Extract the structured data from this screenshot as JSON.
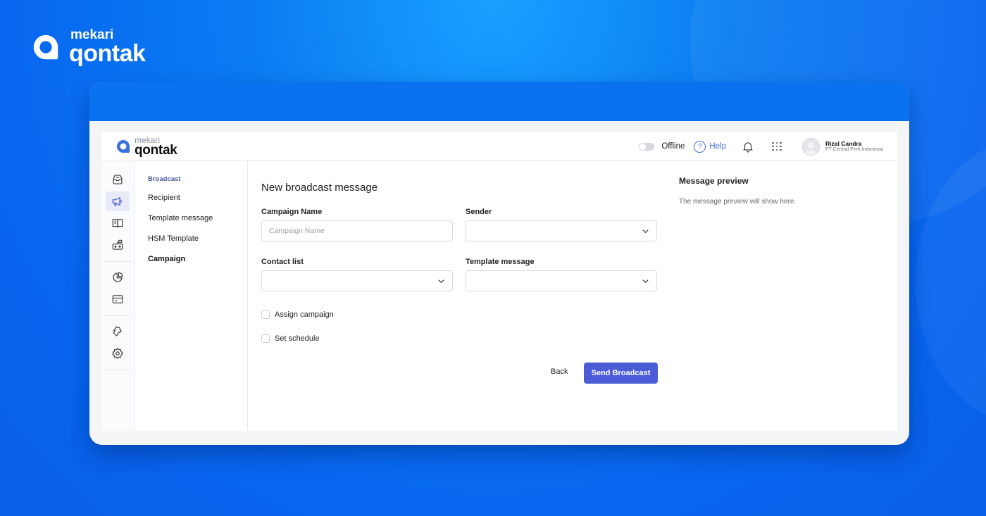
{
  "brand": {
    "small": "mekari",
    "big": "qontak"
  },
  "topbar": {
    "logo_small": "mekari",
    "logo_big": "qontak",
    "status_label": "Offline",
    "help_label": "Help",
    "help_glyph": "?",
    "user_name": "Rizal Candra",
    "user_company": "PT Central Perk Indonesia"
  },
  "rail": {
    "items": [
      {
        "icon": "inbox-icon",
        "active": false
      },
      {
        "icon": "megaphone-icon",
        "active": true
      },
      {
        "icon": "book-icon",
        "active": false
      },
      {
        "icon": "bot-icon",
        "active": false
      },
      {
        "icon": "pie-chart-icon",
        "active": false
      },
      {
        "icon": "credit-card-icon",
        "active": false
      },
      {
        "icon": "puzzle-icon",
        "active": false
      },
      {
        "icon": "gear-icon",
        "active": false
      }
    ]
  },
  "subnav": {
    "heading": "Broadcast",
    "items": [
      "Recipient",
      "Template message",
      "HSM Template",
      "Campaign"
    ],
    "active": "Campaign"
  },
  "form": {
    "title": "New broadcast message",
    "campaign_name": {
      "label": "Campaign Name",
      "placeholder": "Campaign Name",
      "value": ""
    },
    "sender": {
      "label": "Sender",
      "value": ""
    },
    "contact_list": {
      "label": "Contact list",
      "value": ""
    },
    "template_message": {
      "label": "Template message",
      "value": ""
    },
    "assign_campaign": {
      "label": "Assign campaign",
      "checked": false
    },
    "set_schedule": {
      "label": "Set schedule",
      "checked": false
    },
    "back_label": "Back",
    "send_label": "Send Broadcast"
  },
  "preview": {
    "heading": "Message preview",
    "text": "The message preview will show here."
  },
  "colors": {
    "primary_button": "#4b5cd6",
    "link_blue": "#4a6fd6",
    "background_blue": "#0a72f0"
  }
}
